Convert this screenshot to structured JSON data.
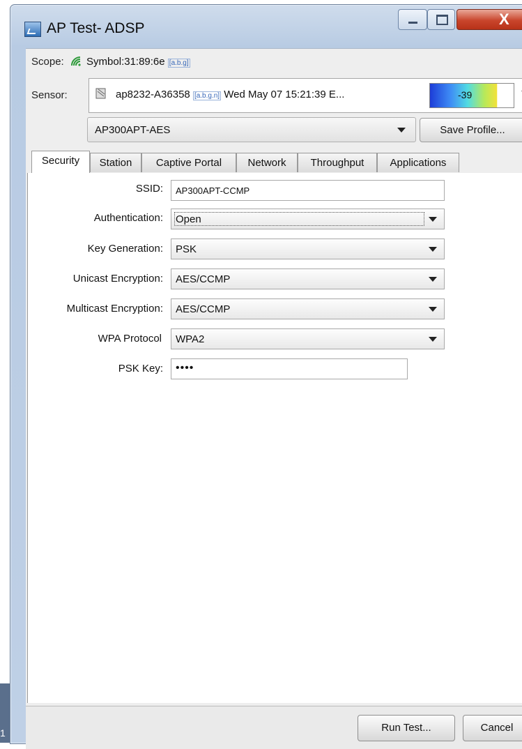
{
  "window": {
    "title": "AP Test- ADSP",
    "close_glyph": "X"
  },
  "taskbar_fragment": "1",
  "scope": {
    "label": "Scope:",
    "value": "Symbol:31:89:6e",
    "tag": "[a.b.g]",
    "icon": "wifi-signal-icon"
  },
  "sensor": {
    "label": "Sensor:",
    "name": "ap8232-A36358",
    "tag": "[a.b.g.n]",
    "timestamp": "Wed May 07 15:21:39 E...",
    "signal_value": "-39",
    "icon": "sensor-device-icon"
  },
  "profile": {
    "selected": "AP300APT-AES",
    "save_label": "Save Profile..."
  },
  "tabs": [
    "Security",
    "Station",
    "Captive Portal",
    "Network",
    "Throughput",
    "Applications"
  ],
  "form": {
    "ssid_label": "SSID:",
    "ssid_value": "AP300APT-CCMP",
    "auth_label": "Authentication:",
    "auth_value": "Open",
    "keygen_label": "Key Generation:",
    "keygen_value": "PSK",
    "unicast_label": "Unicast Encryption:",
    "unicast_value": "AES/CCMP",
    "multicast_label": "Multicast Encryption:",
    "multicast_value": "AES/CCMP",
    "wpa_label": "WPA Protocol",
    "wpa_value": "WPA2",
    "psk_label": "PSK Key:",
    "psk_value": "••••"
  },
  "buttons": {
    "run": "Run Test...",
    "cancel": "Cancel"
  }
}
